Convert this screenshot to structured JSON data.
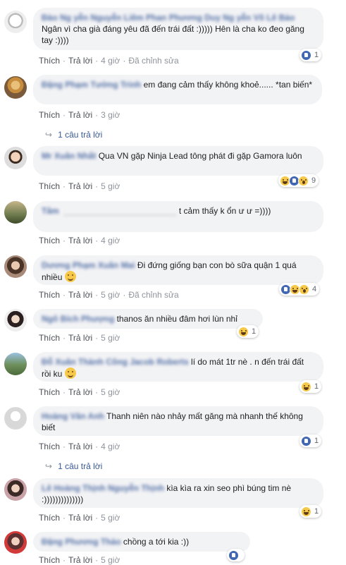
{
  "labels": {
    "like": "Thích",
    "reply": "Trả lời",
    "edited": "Đã chỉnh sửa",
    "separator": "·"
  },
  "comments": [
    {
      "name": "Đào Ng  yễn Nguyễn Liêm Phan Phương Duy Ng yễn Võ Lê Bảo",
      "text": "Ngân vì cha già đáng yêu đã đến trái đất :))))) Hên là cha ko đeo găng tay :))))",
      "time": "4 giờ",
      "edited": true,
      "reactions": [
        "like"
      ],
      "count": "1"
    },
    {
      "name": "Đặng Phạm Tường Trinh",
      "text": "em đang cảm thấy không khoẻ...... *tan biến*",
      "time": "3 giờ",
      "edited": false,
      "reactions": [],
      "count": ""
    },
    {
      "name": "Mr Xuân Nhất",
      "text": "Qua VN gặp Ninja Lead tông phát đi gặp Gamora luôn",
      "time": "5 giờ",
      "edited": false,
      "reactions": [
        "haha",
        "like",
        "wow"
      ],
      "count": "9"
    },
    {
      "name": "Tâm",
      "text": "t cảm thấy k ổn ư ư =))))",
      "time": "4 giờ",
      "edited": false,
      "reactions": [],
      "count": ""
    },
    {
      "name": "Dương Phạm Xuân Mai",
      "text": "Đi đứng giống bạn con bò sữa quận 1 quá nhiều",
      "time": "5 giờ",
      "edited": true,
      "reactions": [
        "like",
        "haha",
        "wow"
      ],
      "count": "4"
    },
    {
      "name": "Ngô Bích Phượng",
      "text": "thanos ăn nhiều đâm hơi lùn nhỉ",
      "time": "5 giờ",
      "edited": false,
      "reactions": [
        "haha"
      ],
      "count": "1"
    },
    {
      "name": "Đỗ Xuân Thành Công Jacob Roberts",
      "text": "lí do mát 1tr nè . n đến trái đất rồi ku",
      "time": "5 giờ",
      "edited": false,
      "reactions": [
        "haha"
      ],
      "count": "1"
    },
    {
      "name": "Hoàng Văn Anh",
      "text": "Thanh niên nào nhảy mất găng mà nhanh thế không biết",
      "time": "4 giờ",
      "edited": false,
      "reactions": [
        "like"
      ],
      "count": "1"
    },
    {
      "name": "Lê Hoàng Thịnh Nguyễn Thịnh",
      "text": "kìa kìa ra xin seo phì búng tim nè :))))))))))))))",
      "time": "5 giờ",
      "edited": false,
      "reactions": [
        "haha"
      ],
      "count": "1"
    },
    {
      "name": "Đặng Phương Thảo",
      "text": "chồng a tới kia :))",
      "time": "5 giờ",
      "edited": false,
      "reactions": [
        "like"
      ],
      "count": ""
    }
  ],
  "replies": [
    {
      "label": "1 câu trả lời"
    },
    {
      "label": "1 câu trả lời"
    }
  ]
}
